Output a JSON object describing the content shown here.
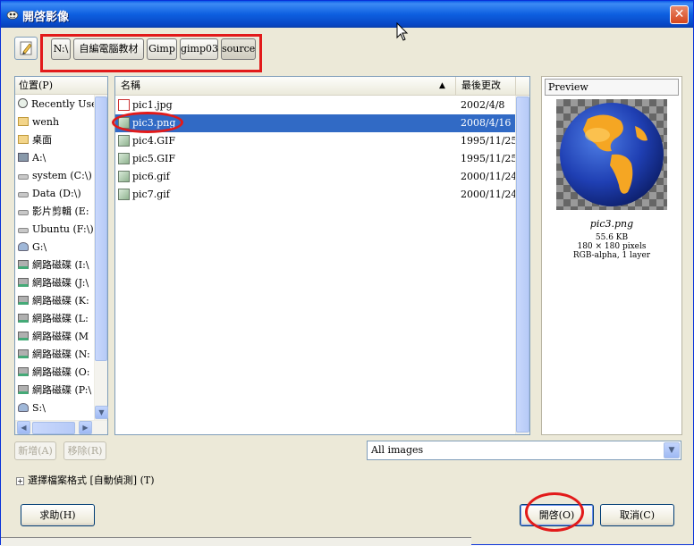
{
  "window": {
    "title": "開啓影像"
  },
  "path_bar": {
    "edit_icon": "pencil-icon",
    "crumbs": [
      "N:\\",
      "自編電腦教材",
      "Gimp",
      "gimp03",
      "source"
    ]
  },
  "places": {
    "header": "位置(P)",
    "items": [
      {
        "label": "Recently Used",
        "icon": "clock-icon"
      },
      {
        "label": "wenh",
        "icon": "folder-icon"
      },
      {
        "label": "桌面",
        "icon": "folder-icon"
      },
      {
        "label": "A:\\",
        "icon": "floppy-icon"
      },
      {
        "label": "system (C:\\)",
        "icon": "drive-icon"
      },
      {
        "label": "Data (D:\\)",
        "icon": "drive-icon"
      },
      {
        "label": "影片剪輯 (E:",
        "icon": "drive-icon"
      },
      {
        "label": "Ubuntu (F:\\)",
        "icon": "drive-icon"
      },
      {
        "label": "G:\\",
        "icon": "user-drive-icon"
      },
      {
        "label": "網路磁碟 (I:\\",
        "icon": "network-drive-icon"
      },
      {
        "label": "網路磁碟 (J:\\",
        "icon": "network-drive-icon"
      },
      {
        "label": "網路磁碟 (K:",
        "icon": "network-drive-icon"
      },
      {
        "label": "網路磁碟 (L:",
        "icon": "network-drive-icon"
      },
      {
        "label": "網路磁碟 (M",
        "icon": "network-drive-icon"
      },
      {
        "label": "網路磁碟 (N:",
        "icon": "network-drive-icon"
      },
      {
        "label": "網路磁碟 (O:",
        "icon": "network-drive-icon"
      },
      {
        "label": "網路磁碟 (P:\\",
        "icon": "network-drive-icon"
      },
      {
        "label": "S:\\",
        "icon": "user-drive-icon"
      }
    ],
    "add_label": "新增(A)",
    "remove_label": "移除(R)"
  },
  "files": {
    "name_header": "名稱",
    "modified_header": "最後更改",
    "sort_indicator": "▲",
    "rows": [
      {
        "name": "pic1.jpg",
        "date": "2002/4/8",
        "selected": false,
        "icon": "jpg-file-icon"
      },
      {
        "name": "pic3.png",
        "date": "2008/4/16",
        "selected": true,
        "icon": "image-file-icon"
      },
      {
        "name": "pic4.GIF",
        "date": "1995/11/25",
        "selected": false,
        "icon": "image-file-icon"
      },
      {
        "name": "pic5.GIF",
        "date": "1995/11/25",
        "selected": false,
        "icon": "image-file-icon"
      },
      {
        "name": "pic6.gif",
        "date": "2000/11/24",
        "selected": false,
        "icon": "image-file-icon"
      },
      {
        "name": "pic7.gif",
        "date": "2000/11/24",
        "selected": false,
        "icon": "image-file-icon"
      }
    ]
  },
  "preview": {
    "title": "Preview",
    "file_name": "pic3.png",
    "size": "55.6 KB",
    "dimensions": "180 × 180 pixels",
    "mode": "RGB-alpha, 1 layer"
  },
  "filter": {
    "selected": "All images"
  },
  "file_type_expander": "選擇檔案格式 [自動偵測] (T)",
  "buttons": {
    "help": "求助(H)",
    "open": "開啓(O)",
    "cancel": "取消(C)"
  },
  "colors": {
    "titlebar": "#0a5ae8",
    "selection": "#316ac5",
    "annotation": "#e21a1a",
    "dialog_bg": "#ece9d8"
  }
}
